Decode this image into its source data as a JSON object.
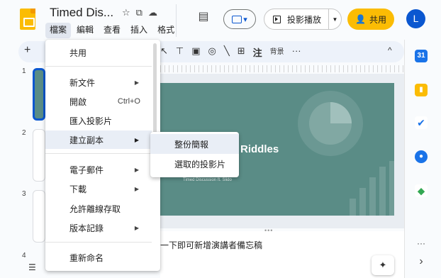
{
  "app": {
    "doc_title": "Timed Dis...",
    "title_icons": [
      "star-icon",
      "folder-move-icon",
      "cloud-status-icon"
    ],
    "menubar": [
      "檔案",
      "編輯",
      "查看",
      "插入",
      "格式"
    ],
    "avatar_letter": "L"
  },
  "header": {
    "slideshow_label": "投影播放",
    "share_label": "共用"
  },
  "toolbar": {
    "plus": "+",
    "background_label": "背景",
    "more": "···",
    "caret": "^"
  },
  "filmstrip": {
    "slide_numbers": [
      "1",
      "2",
      "3",
      "4"
    ]
  },
  "slide": {
    "title": "Riddles",
    "subtitle": "Timed Discussion ft. Slido"
  },
  "notes": {
    "text": "一下即可新增演講者備忘稿"
  },
  "file_menu": {
    "items": [
      {
        "label": "共用",
        "shortcut": "",
        "submenu": false
      },
      {
        "label": "新文件",
        "shortcut": "",
        "submenu": true
      },
      {
        "label": "開啟",
        "shortcut": "Ctrl+O",
        "submenu": false
      },
      {
        "label": "匯入投影片",
        "shortcut": "",
        "submenu": false
      },
      {
        "label": "建立副本",
        "shortcut": "",
        "submenu": true
      },
      {
        "label": "電子郵件",
        "shortcut": "",
        "submenu": true
      },
      {
        "label": "下載",
        "shortcut": "",
        "submenu": true
      },
      {
        "label": "允許離線存取",
        "shortcut": "",
        "submenu": false
      },
      {
        "label": "版本記錄",
        "shortcut": "",
        "submenu": true
      },
      {
        "label": "重新命名",
        "shortcut": "",
        "submenu": false
      }
    ],
    "highlighted": "建立副本"
  },
  "copy_submenu": {
    "items": [
      "整份簡報",
      "選取的投影片"
    ],
    "highlighted": "整份簡報"
  },
  "side_panel": {
    "icons": [
      "calendar-icon",
      "keep-icon",
      "tasks-icon",
      "contacts-icon",
      "maps-icon"
    ],
    "more": "···",
    "expand": "›"
  },
  "colors": {
    "accent": "#0b57d0",
    "share_yellow": "#fbbc04",
    "slide_teal": "#5a8c86",
    "menu_highlight": "#e9eef6"
  }
}
